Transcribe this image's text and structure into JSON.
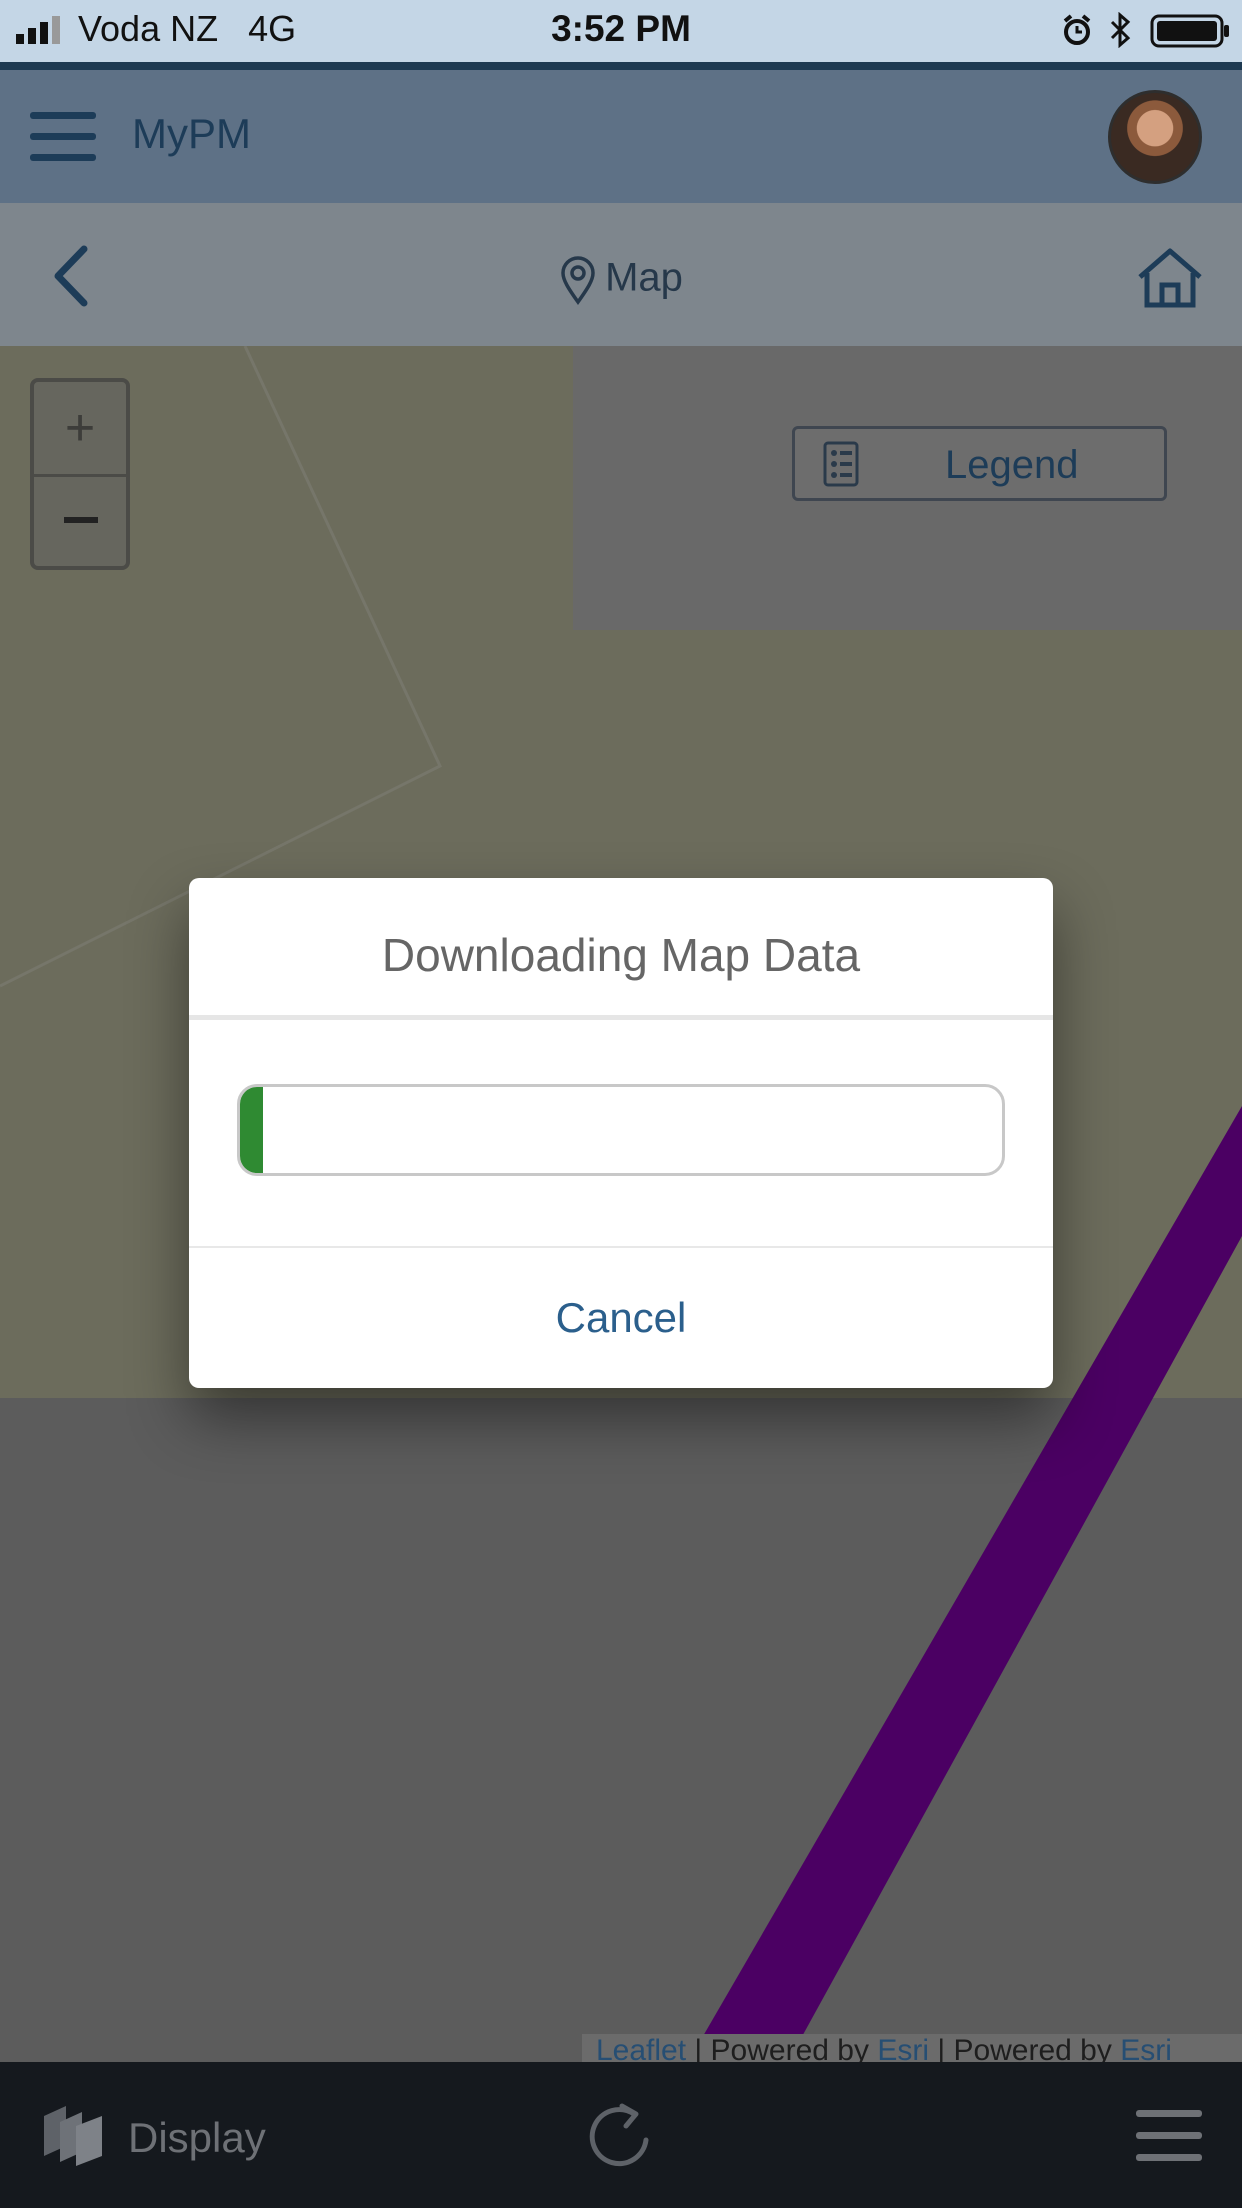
{
  "status_bar": {
    "carrier": "Voda NZ",
    "network": "4G",
    "time": "3:52 PM"
  },
  "header": {
    "title": "MyPM",
    "menu_icon": "hamburger-icon",
    "avatar": "user-avatar"
  },
  "subheader": {
    "title": "Map",
    "back_icon": "chevron-left-icon",
    "pin_icon": "map-pin-icon",
    "home_icon": "home-icon"
  },
  "map": {
    "zoom_in": "+",
    "zoom_out": "−",
    "legend_label": "Legend",
    "attribution": {
      "leaflet": "Leaflet",
      "sep1": " | Powered by ",
      "esri1": "Esri",
      "sep2": " | Powered by ",
      "esri2": "Esri"
    },
    "route_color": "#4b0063"
  },
  "modal": {
    "title": "Downloading Map Data",
    "progress_percent": 3,
    "progress_color": "#2f8a32",
    "cancel_label": "Cancel"
  },
  "bottom_bar": {
    "display_label": "Display",
    "layers_icon": "layers-icon",
    "refresh_icon": "refresh-icon",
    "menu_icon": "hamburger-icon"
  }
}
